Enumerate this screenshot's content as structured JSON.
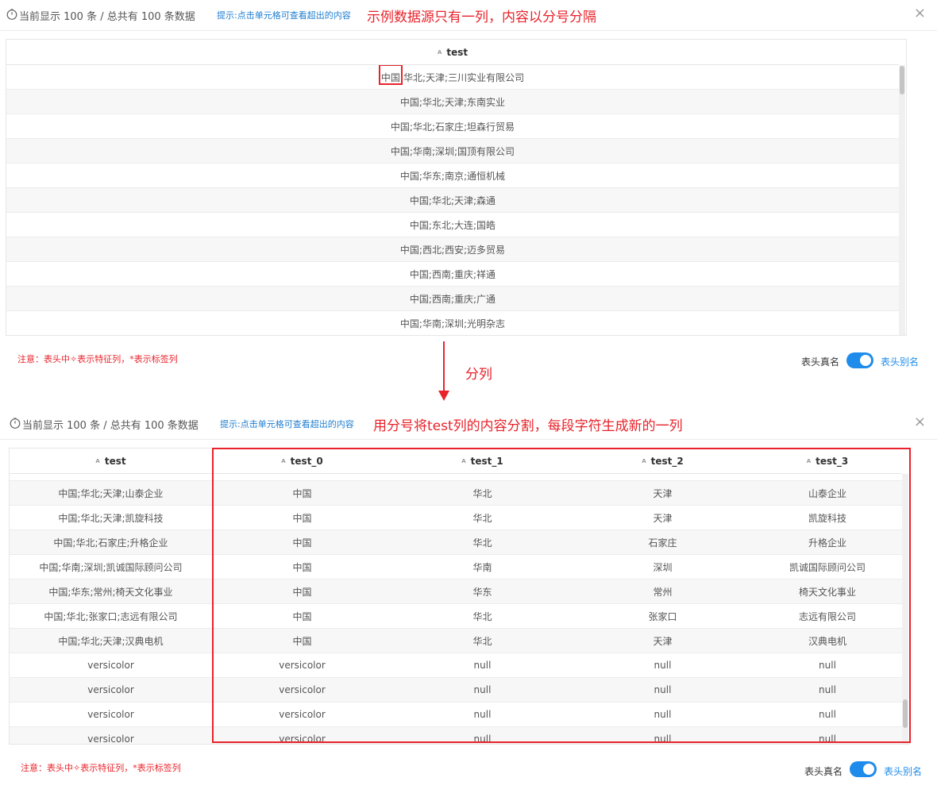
{
  "colors": {
    "accent": "#1f8ceb",
    "annotation": "#e8232b",
    "hint": "#1f7ed0"
  },
  "icons": {
    "header": "clock-icon",
    "close": "close-icon",
    "column_type": "text-type-icon"
  },
  "panel1": {
    "count_text": "当前显示 100 条 / 总共有 100 条数据",
    "hint_text": "提示:点击单元格可查看超出的内容",
    "annotation_text": "示例数据源只有一列，内容以分号分隔",
    "close_symbol": "×",
    "column_type_glyph": "A",
    "columns": [
      "test"
    ],
    "first_cell": {
      "marked": "中国",
      "rest": ";华北;天津;三川实业有限公司"
    },
    "rows": [
      "中国;华北;天津;东南实业",
      "中国;华北;石家庄;坦森行贸易",
      "中国;华南;深圳;国顶有限公司",
      "中国;华东;南京;通恒机械",
      "中国;华北;天津;森通",
      "中国;东北;大连;国皓",
      "中国;西北;西安;迈多贸易",
      "中国;西南;重庆;祥通",
      "中国;西南;重庆;广通",
      "中国;华南;深圳;光明杂志"
    ],
    "footnote": "注意：表头中✧表示特征列，*表示标签列",
    "switch_label": "表头真名",
    "switch_alias": "表头别名"
  },
  "transition": {
    "arrow_label": "分列"
  },
  "panel2": {
    "count_text": "当前显示 100 条 / 总共有 100 条数据",
    "hint_text": "提示:点击单元格可查看超出的内容",
    "annotation_text": "用分号将test列的内容分割，每段字符生成新的一列",
    "close_symbol": "×",
    "column_type_glyph": "A",
    "columns": [
      "test",
      "test_0",
      "test_1",
      "test_2",
      "test_3"
    ],
    "rows": [
      [
        "中国;华北;天津;山泰企业",
        "中国",
        "华北",
        "天津",
        "山泰企业"
      ],
      [
        "中国;华北;天津;凯旋科技",
        "中国",
        "华北",
        "天津",
        "凯旋科技"
      ],
      [
        "中国;华北;石家庄;升格企业",
        "中国",
        "华北",
        "石家庄",
        "升格企业"
      ],
      [
        "中国;华南;深圳;凯诚国际顾问公司",
        "中国",
        "华南",
        "深圳",
        "凯诚国际顾问公司"
      ],
      [
        "中国;华东;常州;椅天文化事业",
        "中国",
        "华东",
        "常州",
        "椅天文化事业"
      ],
      [
        "中国;华北;张家口;志远有限公司",
        "中国",
        "华北",
        "张家口",
        "志远有限公司"
      ],
      [
        "中国;华北;天津;汉典电机",
        "中国",
        "华北",
        "天津",
        "汉典电机"
      ],
      [
        "versicolor",
        "versicolor",
        "null",
        "null",
        "null"
      ],
      [
        "versicolor",
        "versicolor",
        "null",
        "null",
        "null"
      ],
      [
        "versicolor",
        "versicolor",
        "null",
        "null",
        "null"
      ],
      [
        "versicolor",
        "versicolor",
        "null",
        "null",
        "null"
      ]
    ],
    "footnote": "注意：表头中✧表示特征列，*表示标签列",
    "switch_label": "表头真名",
    "switch_alias": "表头别名"
  }
}
